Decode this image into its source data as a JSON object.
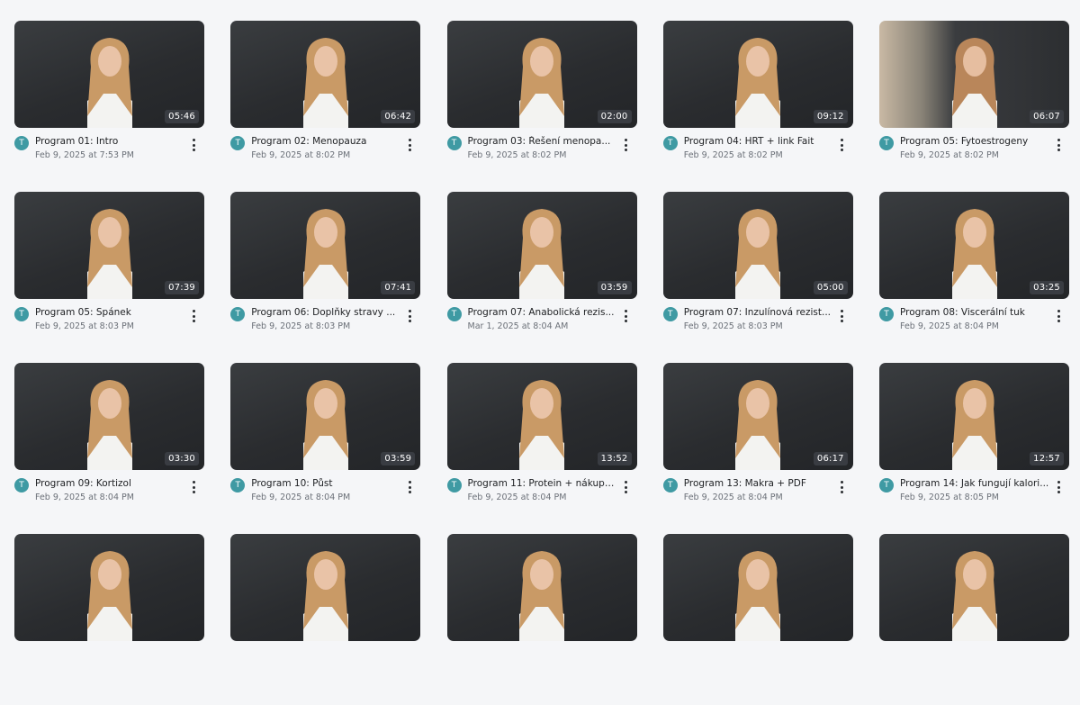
{
  "videos": [
    {
      "title": "Program 01: Intro",
      "date": "Feb 9, 2025 at 7:53 PM",
      "duration": "05:46",
      "avatar": "T"
    },
    {
      "title": "Program 02: Menopauza",
      "date": "Feb 9, 2025 at 8:02 PM",
      "duration": "06:42",
      "avatar": "T"
    },
    {
      "title": "Program 03: Řešení menopa...",
      "date": "Feb 9, 2025 at 8:02 PM",
      "duration": "02:00",
      "avatar": "T"
    },
    {
      "title": "Program 04: HRT + link Fait",
      "date": "Feb 9, 2025 at 8:02 PM",
      "duration": "09:12",
      "avatar": "T"
    },
    {
      "title": "Program 05: Fytoestrogeny",
      "date": "Feb 9, 2025 at 8:02 PM",
      "duration": "06:07",
      "avatar": "T"
    },
    {
      "title": "Program 05: Spánek",
      "date": "Feb 9, 2025 at 8:03 PM",
      "duration": "07:39",
      "avatar": "T"
    },
    {
      "title": "Program 06: Doplňky stravy ...",
      "date": "Feb 9, 2025 at 8:03 PM",
      "duration": "07:41",
      "avatar": "T"
    },
    {
      "title": "Program 07: Anabolická rezis...",
      "date": "Mar 1, 2025 at 8:04 AM",
      "duration": "03:59",
      "avatar": "T"
    },
    {
      "title": "Program 07: Inzulínová rezist...",
      "date": "Feb 9, 2025 at 8:03 PM",
      "duration": "05:00",
      "avatar": "T"
    },
    {
      "title": "Program 08: Viscerální tuk",
      "date": "Feb 9, 2025 at 8:04 PM",
      "duration": "03:25",
      "avatar": "T"
    },
    {
      "title": "Program 09: Kortizol",
      "date": "Feb 9, 2025 at 8:04 PM",
      "duration": "03:30",
      "avatar": "T"
    },
    {
      "title": "Program 10: Půst",
      "date": "Feb 9, 2025 at 8:04 PM",
      "duration": "03:59",
      "avatar": "T"
    },
    {
      "title": "Program 11: Protein + nákupn...",
      "date": "Feb 9, 2025 at 8:04 PM",
      "duration": "13:52",
      "avatar": "T"
    },
    {
      "title": "Program 13: Makra + PDF",
      "date": "Feb 9, 2025 at 8:04 PM",
      "duration": "06:17",
      "avatar": "T"
    },
    {
      "title": "Program 14: Jak fungují kalori...",
      "date": "Feb 9, 2025 at 8:05 PM",
      "duration": "12:57",
      "avatar": "T"
    },
    {
      "title": "",
      "date": "",
      "duration": "",
      "avatar": ""
    },
    {
      "title": "",
      "date": "",
      "duration": "",
      "avatar": ""
    },
    {
      "title": "",
      "date": "",
      "duration": "",
      "avatar": ""
    },
    {
      "title": "",
      "date": "",
      "duration": "",
      "avatar": ""
    },
    {
      "title": "",
      "date": "",
      "duration": "",
      "avatar": ""
    }
  ],
  "colors": {
    "background": "#f5f6f8",
    "avatar": "#3f9aa3",
    "duration_badge": "#3c4046"
  },
  "icons": {
    "more": "vertical-dots-icon",
    "avatar": "avatar-initial"
  }
}
